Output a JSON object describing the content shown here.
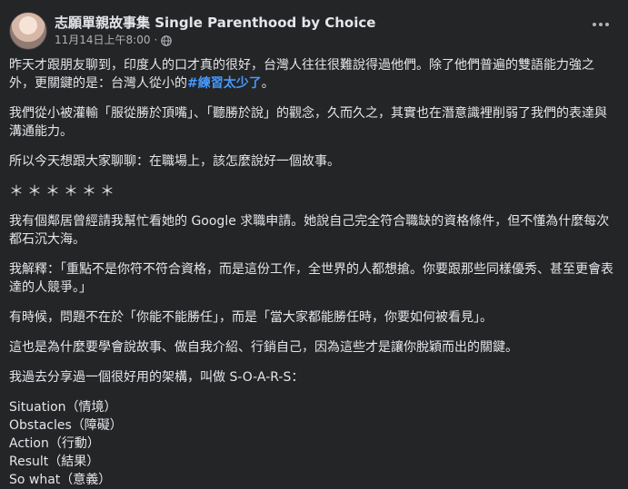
{
  "post": {
    "author": "志願單親故事集 Single Parenthood by Choice",
    "timestamp": "11月14日上午8:00",
    "dot": "·",
    "paragraphs": [
      "昨天才跟朋友聊到，印度人的口才真的很好，台灣人往往很難說得過他們。除了他們普遍的雙語能力強之外，更關鍵的是：台灣人從小的",
      "我們從小被灌輸「服從勝於頂嘴」、「聽勝於說」的觀念，久而久之，其實也在潛意識裡削弱了我們的表達與溝通能力。",
      "所以今天想跟大家聊聊：在職場上，該怎麼說好一個故事。",
      "＊＊＊＊＊＊",
      "我有個鄰居曾經請我幫忙看她的 Google 求職申請。她說自己完全符合職缺的資格條件，但不懂為什麼每次都石沉大海。",
      "我解釋：「重點不是你符不符合資格，而是這份工作，全世界的人都想搶。你要跟那些同樣優秀、甚至更會表達的人競爭。」",
      "有時候，問題不在於「你能不能勝任」，而是「當大家都能勝任時，你要如何被看見」。",
      "這也是為什麼要學會說故事、做自我介紹、行銷自己，因為這些才是讓你脫穎而出的關鍵。",
      "我過去分享過一個很好用的架構，叫做 S-O-A-R-S："
    ],
    "hashtag": "#練習太少了",
    "hashtag_suffix": "。",
    "soars": [
      "Situation（情境）",
      "Obstacles（障礙）",
      "Action（行動）",
      "Result（結果）",
      "So what（意義）"
    ]
  },
  "colors": {
    "background": "#242526",
    "text": "#e4e6eb",
    "secondary": "#b0b3b8",
    "hashtag": "#4599ff"
  },
  "icons": {
    "privacy": "globe-icon",
    "menu": "more-icon"
  }
}
